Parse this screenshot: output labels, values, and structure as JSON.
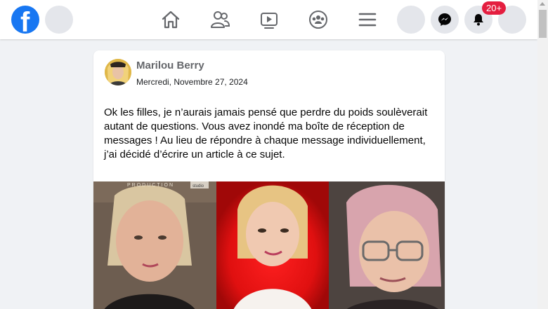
{
  "header": {
    "logo_letter": "f",
    "notification_badge": "20+",
    "nav_icons": [
      "home-icon",
      "friends-icon",
      "watch-icon",
      "groups-icon",
      "menu-icon"
    ],
    "right_icons": [
      "profile-circle",
      "messenger-icon",
      "bell-icon",
      "account-circle"
    ],
    "brand_color": "#1877f2",
    "badge_color": "#e41e3f"
  },
  "post": {
    "author": "Marilou Berry",
    "date": "Mercredi, Novembre 27, 2024",
    "text": "Ok les filles, je n’aurais jamais pensé que perdre du poids soulèverait autant de questions. Vous avez inondé ma boîte de réception de messages ! Au lieu de répondre à chaque message individuellement, j’ai décidé d’écrire un article à ce sujet.",
    "image_overlay_text_1": "PRODUCTION",
    "image_overlay_text_2": "studio"
  }
}
